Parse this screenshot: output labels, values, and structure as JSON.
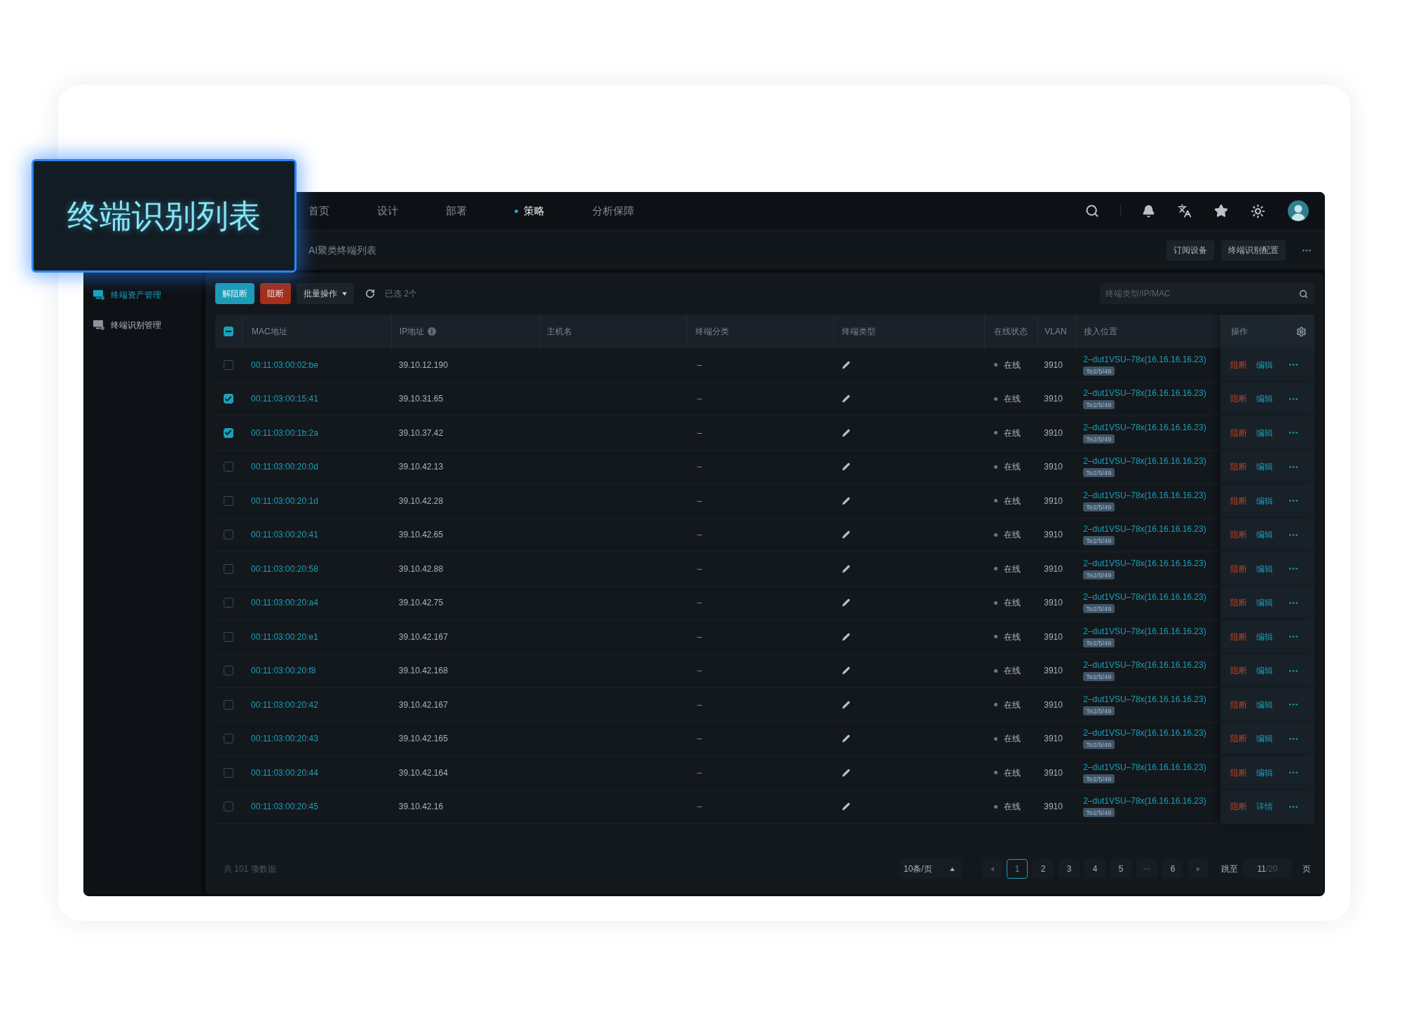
{
  "title_overlay": {
    "text": "终端识别列表"
  },
  "nav": {
    "items": [
      {
        "label": "首页",
        "selected": false
      },
      {
        "label": "设计",
        "selected": false
      },
      {
        "label": "部署",
        "selected": false
      },
      {
        "label": "策略",
        "selected": true
      },
      {
        "label": "分析保障",
        "selected": false
      }
    ]
  },
  "breadcrumb": {
    "text": "AI聚类终端列表"
  },
  "header_actions": [
    "订阅设备",
    "终端识别配置"
  ],
  "sidebar": {
    "items": [
      {
        "label": "终端资产管理",
        "selected": true
      },
      {
        "label": "终端识别管理",
        "selected": false
      }
    ]
  },
  "toolbar": {
    "buttons": [
      {
        "label": "解阻断",
        "kind": "primary"
      },
      {
        "label": "阻断",
        "kind": "danger"
      },
      {
        "label": "批量操作",
        "kind": "dropdown"
      }
    ],
    "selection_text": "已选 2个"
  },
  "search": {
    "placeholder": "终端类型/IP/MAC"
  },
  "table": {
    "select_all": {
      "indeterminate": true
    },
    "columns": [
      {
        "label": "MAC地址"
      },
      {
        "label": "IP地址",
        "info": true
      },
      {
        "label": "主机名"
      },
      {
        "label": "终端分类"
      },
      {
        "label": "终端类型"
      },
      {
        "label": "在线状态"
      },
      {
        "label": "VLAN"
      },
      {
        "label": "接入位置"
      },
      {
        "label": "操作"
      }
    ],
    "rows": [
      {
        "checked": false,
        "mac": "00:11:03:00:02:be",
        "ip": "39.10.12.190",
        "category": "–",
        "status": "在线",
        "vlan": "3910",
        "location": "2–dut1VSU–78x(16.16.16.16.23)",
        "port": "Te2/5/49",
        "actions": [
          {
            "label": "阻断",
            "kind": "danger"
          },
          {
            "label": "编辑",
            "kind": "link"
          }
        ]
      },
      {
        "checked": true,
        "mac": "00:11:03:00:15:41",
        "ip": "39.10.31.65",
        "category": "–",
        "status": "在线",
        "vlan": "3910",
        "location": "2–dut1VSU–78x(16.16.16.16.23)",
        "port": "Te2/5/49",
        "actions": [
          {
            "label": "阻断",
            "kind": "danger"
          },
          {
            "label": "编辑",
            "kind": "link"
          }
        ]
      },
      {
        "checked": true,
        "mac": "00:11:03:00:1b:2a",
        "ip": "39.10.37.42",
        "category": "–",
        "status": "在线",
        "vlan": "3910",
        "location": "2–dut1VSU–78x(16.16.16.16.23)",
        "port": "Te2/5/49",
        "actions": [
          {
            "label": "阻断",
            "kind": "danger"
          },
          {
            "label": "编辑",
            "kind": "link"
          }
        ]
      },
      {
        "checked": false,
        "mac": "00:11:03:00:20:0d",
        "ip": "39.10.42.13",
        "category": "–",
        "status": "在线",
        "vlan": "3910",
        "location": "2–dut1VSU–78x(16.16.16.16.23)",
        "port": "Te2/5/49",
        "actions": [
          {
            "label": "阻断",
            "kind": "danger"
          },
          {
            "label": "编辑",
            "kind": "link"
          }
        ]
      },
      {
        "checked": false,
        "mac": "00:11:03:00:20:1d",
        "ip": "39.10.42.28",
        "category": "–",
        "status": "在线",
        "vlan": "3910",
        "location": "2–dut1VSU–78x(16.16.16.16.23)",
        "port": "Te2/5/49",
        "actions": [
          {
            "label": "阻断",
            "kind": "danger"
          },
          {
            "label": "编辑",
            "kind": "link"
          }
        ]
      },
      {
        "checked": false,
        "mac": "00:11:03:00:20:41",
        "ip": "39.10.42.65",
        "category": "–",
        "status": "在线",
        "vlan": "3910",
        "location": "2–dut1VSU–78x(16.16.16.16.23)",
        "port": "Te2/5/49",
        "actions": [
          {
            "label": "阻断",
            "kind": "danger"
          },
          {
            "label": "编辑",
            "kind": "link"
          }
        ]
      },
      {
        "checked": false,
        "mac": "00:11:03:00:20:58",
        "ip": "39.10.42.88",
        "category": "–",
        "status": "在线",
        "vlan": "3910",
        "location": "2–dut1VSU–78x(16.16.16.16.23)",
        "port": "Te2/5/49",
        "actions": [
          {
            "label": "阻断",
            "kind": "danger"
          },
          {
            "label": "编辑",
            "kind": "link"
          }
        ]
      },
      {
        "checked": false,
        "mac": "00:11:03:00:20:a4",
        "ip": "39.10.42.75",
        "category": "–",
        "status": "在线",
        "vlan": "3910",
        "location": "2–dut1VSU–78x(16.16.16.16.23)",
        "port": "Te2/5/49",
        "actions": [
          {
            "label": "阻断",
            "kind": "danger"
          },
          {
            "label": "编辑",
            "kind": "link"
          }
        ]
      },
      {
        "checked": false,
        "mac": "00:11:03:00:20:e1",
        "ip": "39.10.42.167",
        "category": "–",
        "status": "在线",
        "vlan": "3910",
        "location": "2–dut1VSU–78x(16.16.16.16.23)",
        "port": "Te2/5/49",
        "actions": [
          {
            "label": "阻断",
            "kind": "danger"
          },
          {
            "label": "编辑",
            "kind": "link"
          }
        ]
      },
      {
        "checked": false,
        "mac": "00:11:03:00:20:f8",
        "ip": "39.10.42.168",
        "category": "–",
        "status": "在线",
        "vlan": "3910",
        "location": "2–dut1VSU–78x(16.16.16.16.23)",
        "port": "Te2/5/49",
        "actions": [
          {
            "label": "阻断",
            "kind": "danger"
          },
          {
            "label": "编辑",
            "kind": "link"
          }
        ]
      },
      {
        "checked": false,
        "mac": "00:11:03:00:20:42",
        "ip": "39.10.42.167",
        "category": "–",
        "status": "在线",
        "vlan": "3910",
        "location": "2–dut1VSU–78x(16.16.16.16.23)",
        "port": "Te2/5/49",
        "actions": [
          {
            "label": "阻断",
            "kind": "danger"
          },
          {
            "label": "编辑",
            "kind": "link"
          }
        ]
      },
      {
        "checked": false,
        "mac": "00:11:03:00:20:43",
        "ip": "39.10.42.165",
        "category": "–",
        "status": "在线",
        "vlan": "3910",
        "location": "2–dut1VSU–78x(16.16.16.16.23)",
        "port": "Te2/5/49",
        "actions": [
          {
            "label": "阻断",
            "kind": "danger"
          },
          {
            "label": "编辑",
            "kind": "link"
          }
        ]
      },
      {
        "checked": false,
        "mac": "00:11:03:00:20:44",
        "ip": "39.10.42.164",
        "category": "–",
        "status": "在线",
        "vlan": "3910",
        "location": "2–dut1VSU–78x(16.16.16.16.23)",
        "port": "Te2/5/49",
        "actions": [
          {
            "label": "阻断",
            "kind": "danger"
          },
          {
            "label": "编辑",
            "kind": "link"
          }
        ]
      },
      {
        "checked": false,
        "mac": "00:11:03:00:20:45",
        "ip": "39.10.42.16",
        "category": "–",
        "status": "在线",
        "vlan": "3910",
        "location": "2–dut1VSU–78x(16.16.16.16.23)",
        "port": "Te2/5/49",
        "actions": [
          {
            "label": "阻断",
            "kind": "danger"
          },
          {
            "label": "详情",
            "kind": "link"
          }
        ]
      }
    ]
  },
  "footer": {
    "total": "共 101 项数据",
    "page_size": "10条/页",
    "pages": [
      {
        "kind": "page",
        "label": "1",
        "selected": true
      },
      {
        "kind": "page",
        "label": "2",
        "selected": false
      },
      {
        "kind": "page",
        "label": "3",
        "selected": false
      },
      {
        "kind": "page",
        "label": "4",
        "selected": false
      },
      {
        "kind": "page",
        "label": "5",
        "selected": false
      },
      {
        "kind": "ellipsis",
        "selected": false
      },
      {
        "kind": "page",
        "label": "6",
        "selected": false
      }
    ],
    "jump_label": "跳至",
    "jump_value": "11",
    "jump_total": "/20",
    "page_unit": "页"
  }
}
